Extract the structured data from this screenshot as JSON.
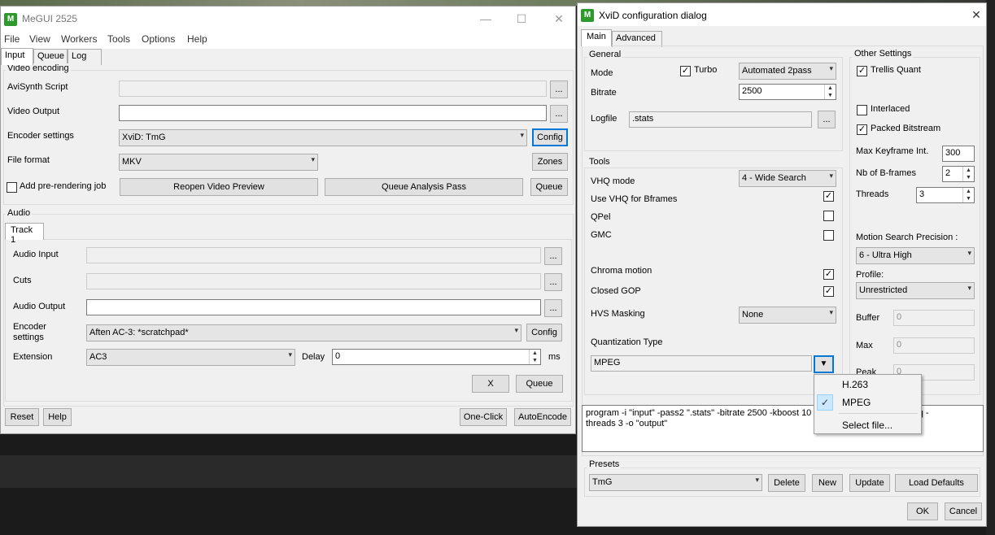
{
  "megui": {
    "title": "MeGUI 2525",
    "menu": [
      "File",
      "View",
      "Workers",
      "Tools",
      "Options",
      "Help"
    ],
    "tabs": [
      "Input",
      "Queue",
      "Log"
    ],
    "video_group": "Video encoding",
    "avisynth_label": "AviSynth Script",
    "avisynth_value": "",
    "video_output_label": "Video Output",
    "video_output_value": "",
    "encoder_settings_label": "Encoder settings",
    "encoder_settings_value": "XviD: TmG",
    "config_label": "Config",
    "file_format_label": "File format",
    "file_format_value": "MKV",
    "zones_label": "Zones",
    "prerender_label": "Add pre-rendering job",
    "reopen_label": "Reopen Video Preview",
    "queue_analysis_label": "Queue Analysis Pass",
    "queue_label": "Queue",
    "browse": "...",
    "audio_group": "Audio",
    "audio_tab": "Track 1",
    "audio_input_label": "Audio Input",
    "cuts_label": "Cuts",
    "audio_output_label": "Audio Output",
    "audio_encoder_label": "Encoder\nsettings",
    "audio_encoder_value": "Aften AC-3: *scratchpad*",
    "extension_label": "Extension",
    "extension_value": "AC3",
    "delay_label": "Delay",
    "delay_value": "0",
    "ms_label": "ms",
    "x_label": "X",
    "reset_label": "Reset",
    "help_label": "Help",
    "oneclick_label": "One-Click",
    "autoencode_label": "AutoEncode"
  },
  "xvid": {
    "title": "XviD configuration dialog",
    "tabs": [
      "Main",
      "Advanced"
    ],
    "general_group": "General",
    "mode_label": "Mode",
    "turbo_label": "Turbo",
    "turbo_checked": true,
    "mode_value": "Automated 2pass",
    "bitrate_label": "Bitrate",
    "bitrate_value": "2500",
    "logfile_label": "Logfile",
    "logfile_value": ".stats",
    "browse": "...",
    "tools_group": "Tools",
    "vhq_label": "VHQ mode",
    "vhq_value": "4 - Wide Search",
    "vhq_bframes_label": "Use VHQ for Bframes",
    "qpel_label": "QPel",
    "gmc_label": "GMC",
    "chroma_label": "Chroma motion",
    "closed_gop_label": "Closed GOP",
    "hvs_label": "HVS Masking",
    "hvs_value": "None",
    "quant_label": "Quantization Type",
    "quant_value": "MPEG",
    "other_group": "Other Settings",
    "trellis_label": "Trellis Quant",
    "interlaced_label": "Interlaced",
    "packed_label": "Packed Bitstream",
    "max_keyframe_label": "Max Keyframe Int.",
    "max_keyframe_value": "300",
    "bframes_label": "Nb of B-frames",
    "bframes_value": "2",
    "threads_label": "Threads",
    "threads_value": "3",
    "motion_label": "Motion Search Precision :",
    "motion_value": "6 - Ultra High",
    "profile_label": "Profile:",
    "profile_value": "Unrestricted",
    "buffer_label": "Buffer",
    "buffer_value": "0",
    "max_label": "Max",
    "max_value": "0",
    "peak_label": "Peak",
    "peak_value": "0",
    "commandline": "program -i \"input\" -pass2 \".stats\" -bitrate 2500 -kboost 10                                 1 -bvhq -\nthreads 3 -o \"output\"",
    "presets_group": "Presets",
    "preset_value": "TmG",
    "delete_label": "Delete",
    "new_label": "New",
    "update_label": "Update",
    "load_defaults_label": "Load Defaults",
    "ok_label": "OK",
    "cancel_label": "Cancel"
  },
  "quant_dropdown": {
    "items": [
      {
        "label": "H.263",
        "checked": false
      },
      {
        "label": "MPEG",
        "checked": true
      },
      {
        "label": "Select file...",
        "checked": false
      }
    ]
  },
  "checks": {
    "mark": "✓"
  }
}
